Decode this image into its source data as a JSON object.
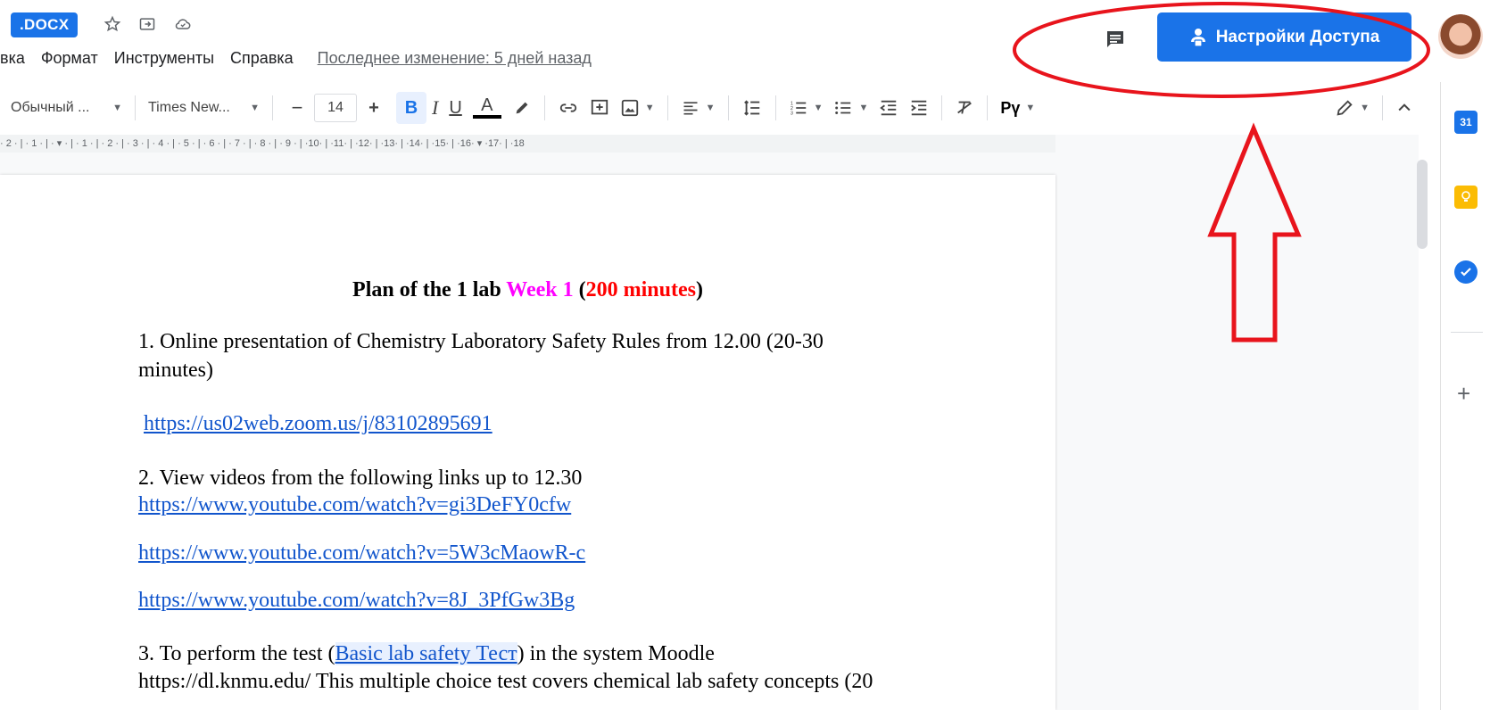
{
  "header": {
    "doc_badge": ".DOCX",
    "menu": [
      "вка",
      "Формат",
      "Инструменты",
      "Справка"
    ],
    "last_edit": "Последнее изменение: 5 дней назад",
    "share_label": "Настройки Доступа"
  },
  "toolbar": {
    "style": "Обычный ...",
    "font": "Times New...",
    "minus": "−",
    "size": "14",
    "plus": "+",
    "bold": "B",
    "italic": "I",
    "underline": "U",
    "text_color": "A",
    "spell": "Pү",
    "spell_label_color": "#000000"
  },
  "ruler": {
    "marks": "· 2 · | · 1 · | · ▾ · | · 1 · | · 2 · | · 3 · | · 4 · | · 5 · | · 6 · | · 7 · | · 8 · | · 9 · | ·10· | ·11· | ·12· | ·13· | ·14· | ·15· | ·16· ▾ ·17· | ·18"
  },
  "document": {
    "title_parts": {
      "a": "Plan of the 1 lab ",
      "b": "Week 1",
      "c": " (",
      "d": "200 minutes",
      "e": ")"
    },
    "item1_line1": "1. Online presentation of  Chemistry Laboratory Safety Rules  from 12.00   (20-30",
    "item1_line2": "minutes)",
    "zoom_link": "https://us02web.zoom.us/j/83102895691",
    "item2_text": "2. View videos from the following links up to 12.30",
    "yt1": "https://www.youtube.com/watch?v=gi3DeFY0cfw",
    "yt2": "https://www.youtube.com/watch?v=5W3cMaowR-c",
    "yt3": "https://www.youtube.com/watch?v=8J_3PfGw3Bg",
    "item3_pre": "3. To perform the test (",
    "item3_link": "Basic lab safety Тест",
    "item3_post": ") in the system Moodle",
    "item3_cut": "https://dl.knmu.edu/  This multiple choice test covers chemical lab safety concepts (20"
  },
  "side": {
    "calendar_label": "31"
  },
  "colors": {
    "accent": "#1a73e8",
    "annotation": "#e8141c",
    "link": "#1155cc"
  }
}
